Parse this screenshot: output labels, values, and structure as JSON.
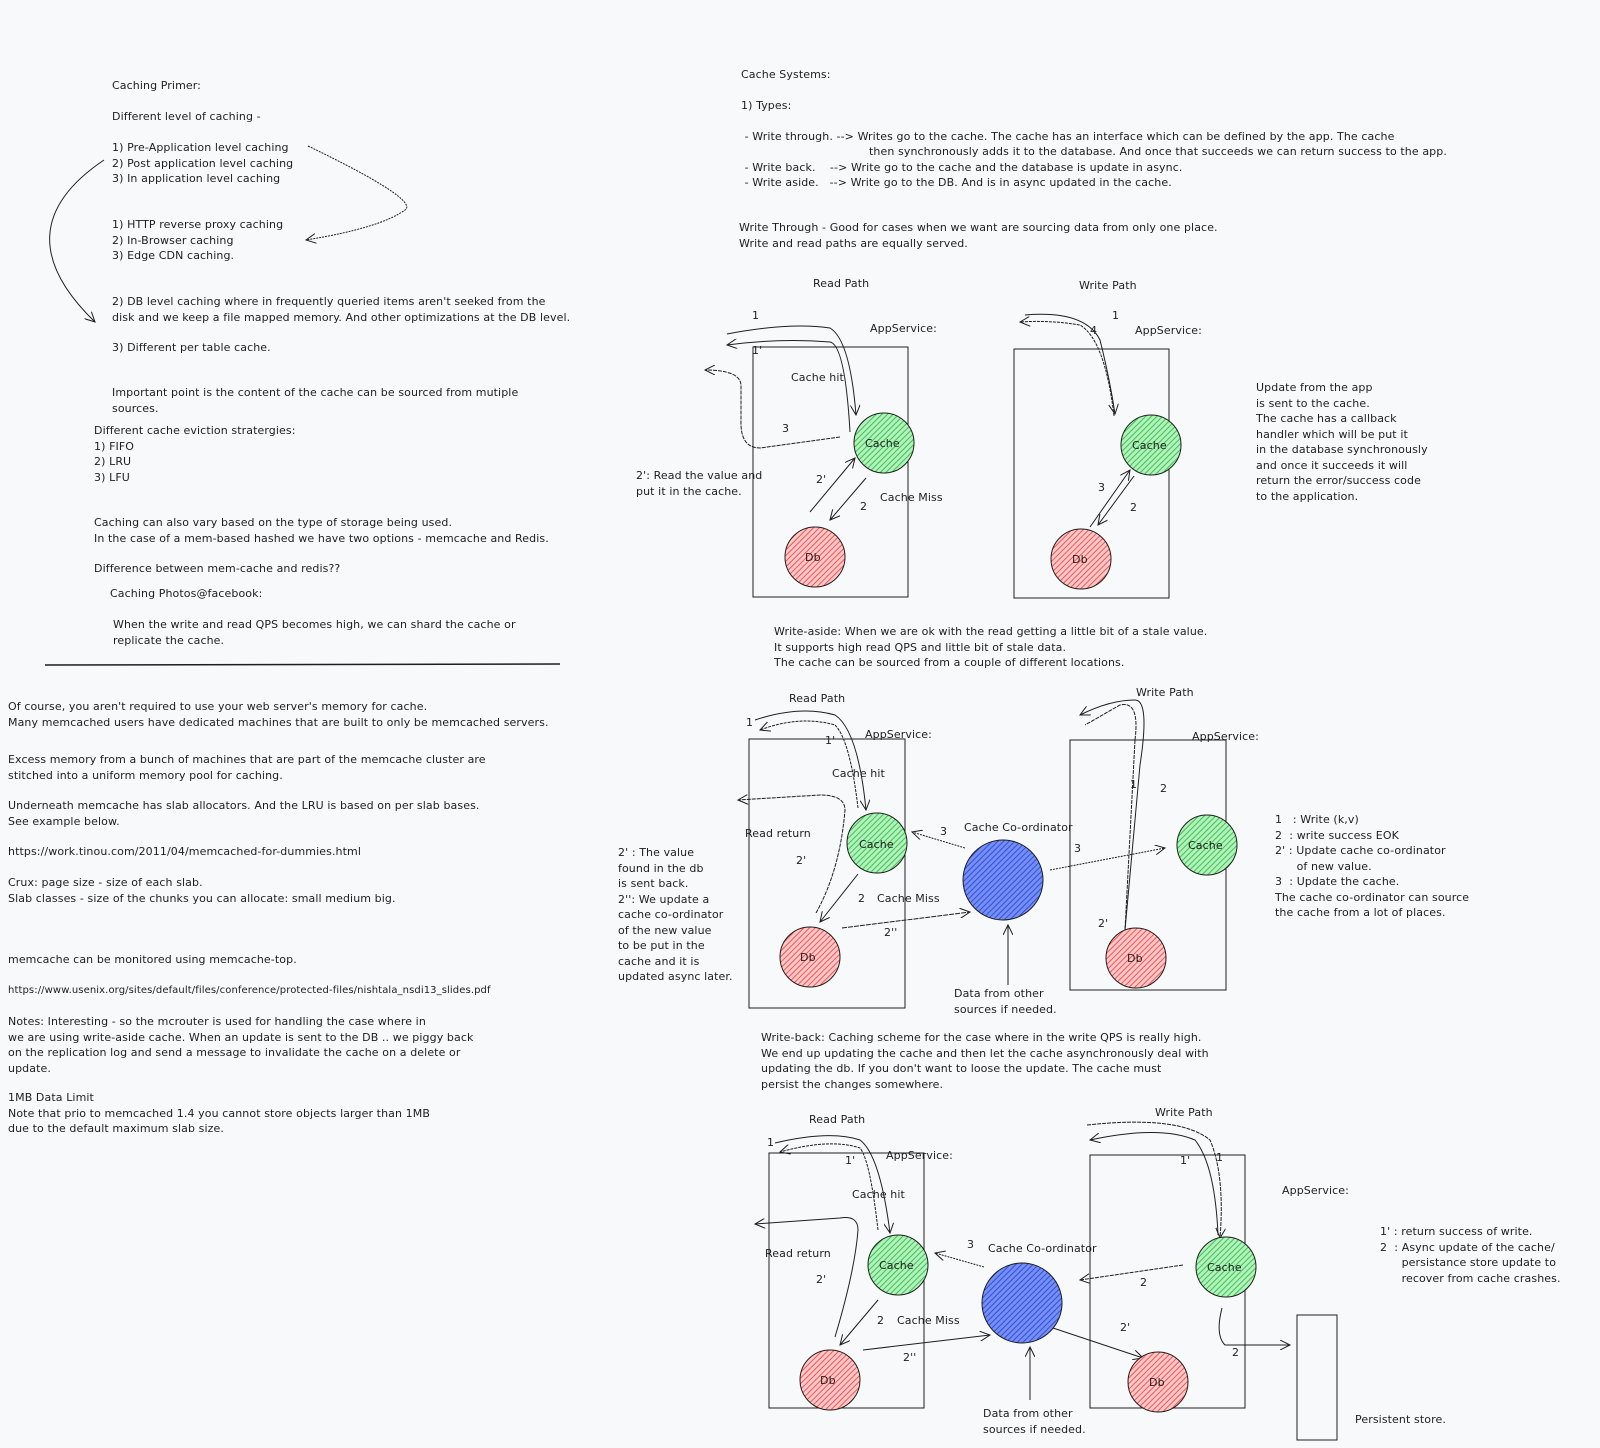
{
  "primer": {
    "title": "Caching Primer:",
    "levels_heading": "Different level of caching -",
    "levels": "1) Pre-Application level caching\n2) Post application level caching\n3) In application level caching",
    "pre_app": "1) HTTP reverse proxy caching\n2) In-Browser caching\n3) Edge CDN caching.",
    "db_level": "2) DB level caching where in frequently queried items aren't seeked from the\ndisk and we keep a file mapped memory. And other optimizations at the DB level.",
    "per_table": "3) Different per table cache.",
    "important": "Important point is the content of the cache can be sourced from mutiple\nsources.",
    "eviction": "Different cache eviction stratergies:\n1) FIFO\n2) LRU\n3) LFU",
    "storage": "Caching can also vary based on the type of storage being used.\nIn the case of a mem-based hashed we have two options - memcache and Redis.",
    "difference": "Difference between mem-cache and redis??",
    "photos": "Caching Photos@facebook:",
    "qps": "When the write and read QPS becomes high, we can shard the cache or\nreplicate the cache."
  },
  "memcache_notes": {
    "dedicated": "Of course, you aren't required to use your web server's memory for cache.\nMany memcached users have dedicated machines that are built to only be memcached servers.",
    "excess": "Excess memory from a bunch of machines that are part of the memcache cluster are\nstitched into a uniform memory pool for caching.",
    "slab": "Underneath memcache has slab allocators. And the LRU is based on per slab bases.\nSee example below.",
    "link1": "https://work.tinou.com/2011/04/memcached-for-dummies.html",
    "crux": "Crux: page size - size of each slab.\nSlab classes - size of the chunks you can allocate: small medium big.",
    "monitor": "memcache can be monitored using memcache-top.",
    "link2": "https://www.usenix.org/sites/default/files/conference/protected-files/nishtala_nsdi13_slides.pdf",
    "notes": "Notes: Interesting - so the mcrouter is used for handling the case where in\nwe are using write-aside cache. When an update is sent to the DB .. we piggy back\non the replication log and send a message to invalidate the cache on a delete or\nupdate.",
    "limit": "1MB Data Limit\nNote that prio to memcached 1.4 you cannot store objects larger than 1MB\ndue to the default maximum slab size."
  },
  "cache_systems": {
    "title": "Cache Systems:",
    "types": "1) Types:",
    "wt1": " - Write through. --> Writes go to the cache. The cache has an interface which can be defined by the app. The cache",
    "wt2": "then synchronously adds it to the database. And once that succeeds we can return success to the app.",
    "wb": " - Write back.    --> Write go to the cache and the database is update in async.",
    "wa": " - Write aside.   --> Write go to the DB. And is in async updated in the cache.",
    "wt_note": "Write Through - Good for cases when we want are sourcing data from only one place.\nWrite and read paths are equally served."
  },
  "common": {
    "read_path": "Read Path",
    "write_path": "Write Path",
    "app_service": "AppService:",
    "cache": "Cache",
    "db": "Db",
    "cache_hit": "Cache hit",
    "cache_miss": "Cache Miss",
    "read_return": "Read return",
    "coordinator": "Cache Co-ordinator",
    "data_other": "Data from other\nsources if needed.",
    "l1": "1",
    "l1p": "1'",
    "l2": "2",
    "l2p": "2'",
    "l2pp": "2''",
    "l3": "3",
    "l4": "4"
  },
  "diagram1": {
    "read_note": "2': Read the value and\nput it in the cache.",
    "write_note": "Update from the app\nis sent to the cache.\nThe cache has a callback\nhandler which will be put it\nin the database synchronously\nand once it succeeds it will\nreturn the error/success code\nto the application.",
    "write_aside": "Write-aside: When we are ok with the read getting a little bit of a stale value.\nIt supports high read QPS and little bit of stale data.\nThe cache can be sourced from a couple of different locations."
  },
  "diagram2": {
    "read_note": "2' : The value\nfound in the db\nis sent back.\n2'': We update a\ncache co-ordinator\nof the new value\nto be put in the\ncache and it is\nupdated async later.",
    "write_legend": "1   : Write (k,v)\n2  : write success EOK\n2' : Update cache co-ordinator\n      of new value.\n3  : Update the cache.\nThe cache co-ordinator can source\nthe cache from a lot of places.",
    "write_back": "Write-back: Caching scheme for the case where in the write QPS is really high.\nWe end up updating the cache and then let the cache asynchronously deal with\nupdating the db. If you don't want to loose the update. The cache must\npersist the changes somewhere."
  },
  "diagram3": {
    "legend": "1' : return success of write.\n2  : Async update of the cache/\n      persistance store update to\n      recover from cache crashes.",
    "persistent": "Persistent store."
  },
  "colors": {
    "cache": "#40c057",
    "db": "#fa5252",
    "coordinator": "#364fc7",
    "ink": "#1e1e1e",
    "background": "#f8f9fa"
  }
}
